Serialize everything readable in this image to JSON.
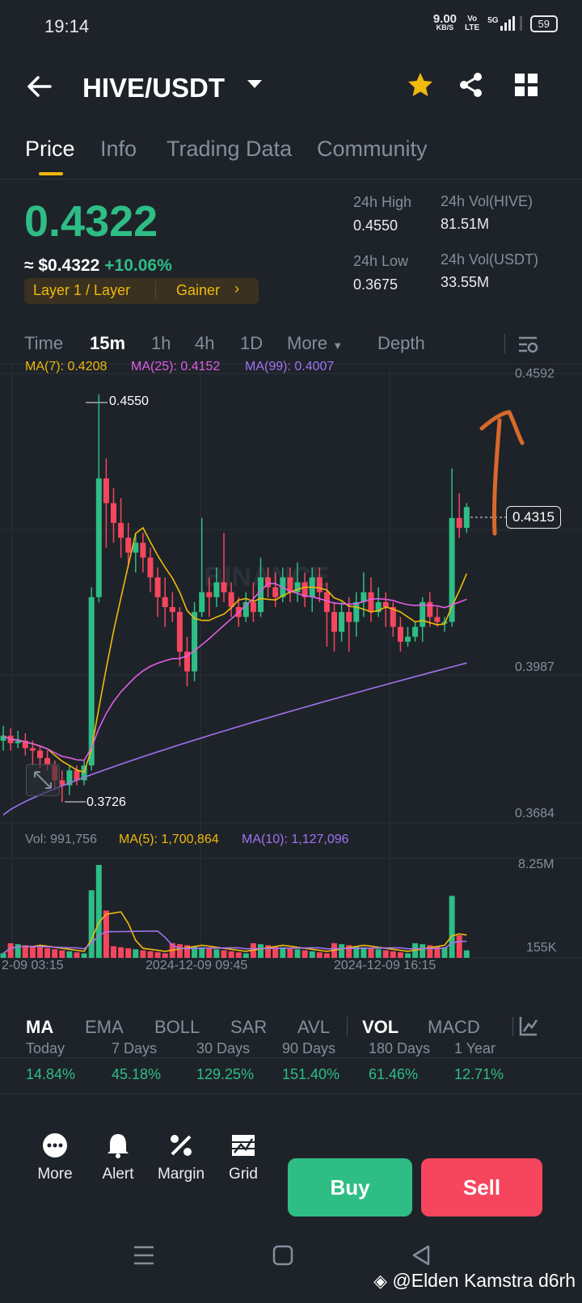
{
  "status": {
    "time": "19:14",
    "speed": "9.00",
    "speed_unit": "KB/S",
    "vo": "Vo",
    "lte": "LTE",
    "net": "5G",
    "battery": "59"
  },
  "header": {
    "pair": "HIVE/USDT"
  },
  "tabs": [
    "Price",
    "Info",
    "Trading Data",
    "Community"
  ],
  "ticker": {
    "price": "0.4322",
    "usd": "≈ $0.4322",
    "change": "+10.06%",
    "tag1": "Layer 1 / Layer",
    "tag2": "Gainer",
    "high_label": "24h High",
    "high": "0.4550",
    "low_label": "24h Low",
    "low": "0.3675",
    "vol_hive_label": "24h Vol(HIVE)",
    "vol_hive": "81.51M",
    "vol_usdt_label": "24h Vol(USDT)",
    "vol_usdt": "33.55M"
  },
  "intervals": [
    "Time",
    "15m",
    "1h",
    "4h",
    "1D",
    "More",
    "Depth"
  ],
  "chart": {
    "ma7": "MA(7): 0.4208",
    "ma25": "MA(25): 0.4152",
    "ma99": "MA(99): 0.4007",
    "axis": [
      "0.4592",
      "0.3987",
      "0.3684"
    ],
    "current": "0.4315",
    "max_label": "0.4550",
    "min_label": "0.3726",
    "vol": "Vol: 991,756",
    "vol_ma5": "MA(5): 1,700,864",
    "vol_ma10": "MA(10): 1,127,096",
    "vol_axis": [
      "8.25M",
      "155K"
    ],
    "times": [
      "2-09 03:15",
      "2024-12-09 09:45",
      "2024-12-09 16:15"
    ],
    "watermark": "BINANCE",
    "colors": {
      "up": "#2ebd85",
      "down": "#f6465d",
      "ma7": "#f0b90b",
      "ma25": "#e05ee6",
      "ma99": "#a073f0"
    }
  },
  "indicators": [
    "MA",
    "EMA",
    "BOLL",
    "SAR",
    "AVL",
    "VOL",
    "MACD"
  ],
  "performance": [
    {
      "label": "Today",
      "value": "14.84%"
    },
    {
      "label": "7 Days",
      "value": "45.18%"
    },
    {
      "label": "30 Days",
      "value": "129.25%"
    },
    {
      "label": "90 Days",
      "value": "151.40%"
    },
    {
      "label": "180 Days",
      "value": "61.46%"
    },
    {
      "label": "1 Year",
      "value": "12.71%"
    }
  ],
  "bottom": {
    "more": "More",
    "alert": "Alert",
    "margin": "Margin",
    "grid": "Grid",
    "buy": "Buy",
    "sell": "Sell"
  },
  "watermark": "@Elden Kamstra d6rh"
}
